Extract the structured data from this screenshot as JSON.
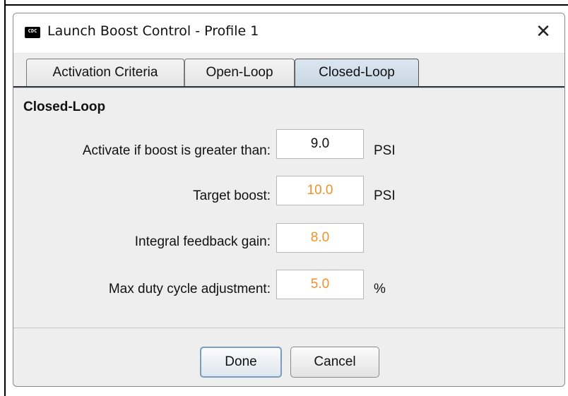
{
  "window": {
    "icon_text": "CDC",
    "title": "Launch Boost Control - Profile 1",
    "close_glyph": "✕"
  },
  "tabs": [
    {
      "label": "Activation Criteria",
      "active": false
    },
    {
      "label": "Open-Loop",
      "active": false
    },
    {
      "label": "Closed-Loop",
      "active": true
    }
  ],
  "section": {
    "title": "Closed-Loop"
  },
  "fields": [
    {
      "label": "Activate if boost is greater than:",
      "value": "9.0",
      "unit": "PSI",
      "color": "#111111"
    },
    {
      "label": "Target boost:",
      "value": "10.0",
      "unit": "PSI",
      "color": "#f0912a"
    },
    {
      "label": "Integral feedback gain:",
      "value": "8.0",
      "unit": "",
      "color": "#f0912a"
    },
    {
      "label": "Max duty cycle adjustment:",
      "value": "5.0",
      "unit": "%",
      "color": "#f0912a"
    }
  ],
  "buttons": {
    "done": "Done",
    "cancel": "Cancel"
  },
  "colors": {
    "modified_value": "#f0912a",
    "active_tab": "#c8d6e3"
  }
}
